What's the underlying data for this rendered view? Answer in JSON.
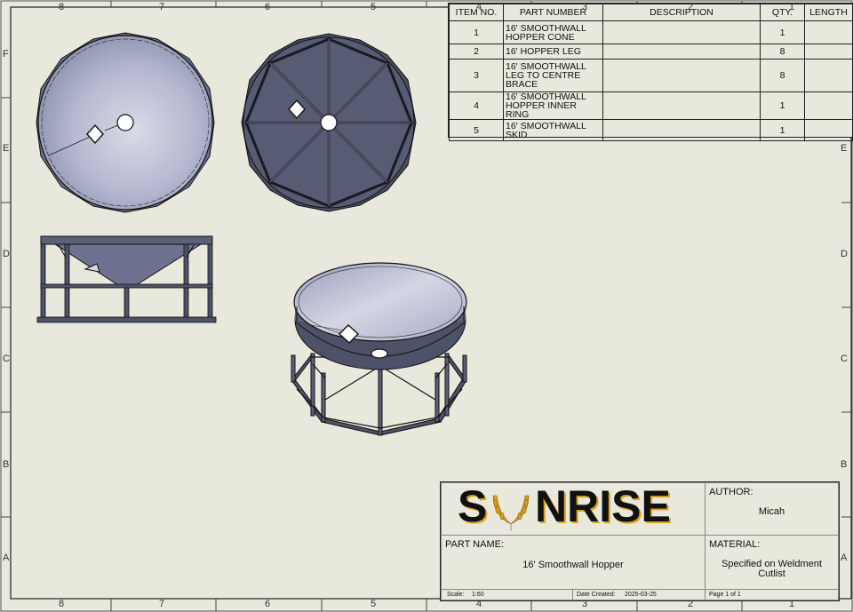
{
  "zones": {
    "columns": [
      "8",
      "7",
      "6",
      "5",
      "4",
      "3",
      "2",
      "1"
    ],
    "rows": [
      "F",
      "E",
      "D",
      "C",
      "B",
      "A"
    ]
  },
  "bom": {
    "headers": {
      "item_no": "ITEM NO.",
      "part_number": "PART NUMBER",
      "description": "DESCRIPTION",
      "qty": "QTY.",
      "length": "LENGTH"
    },
    "rows": [
      {
        "item": "1",
        "part": [
          "16' SMOOTHWALL",
          "HOPPER CONE"
        ],
        "description": "",
        "qty": "1",
        "length": ""
      },
      {
        "item": "2",
        "part": [
          "16' HOPPER LEG"
        ],
        "description": "",
        "qty": "8",
        "length": ""
      },
      {
        "item": "3",
        "part": [
          "16' SMOOTHWALL",
          "LEG TO CENTRE",
          "BRACE"
        ],
        "description": "",
        "qty": "8",
        "length": ""
      },
      {
        "item": "4",
        "part": [
          "16' SMOOTHWALL",
          "HOPPER INNER RING"
        ],
        "description": "",
        "qty": "1",
        "length": ""
      },
      {
        "item": "5",
        "part": [
          "16' SMOOTHWALL",
          "SKID"
        ],
        "description": "",
        "qty": "1",
        "length": ""
      }
    ]
  },
  "title_block": {
    "logo": "SUNRISE",
    "author_label": "AUTHOR:",
    "author": "Micah",
    "part_name_label": "PART NAME:",
    "part_name": "16' Smoothwall Hopper",
    "material_label": "MATERIAL:",
    "material": [
      "Specified on Weldment",
      "Cutlist"
    ],
    "scale_label": "Scale:",
    "scale": "1:60",
    "date_label": "Date Created:",
    "date": "2025-03-25",
    "page": "Page  1  of  1"
  },
  "colors": {
    "sheet": "#e8e8dc",
    "line": "#222222",
    "steel_light": "#b9bcd4",
    "steel_dark": "#545870",
    "logo_black": "#111111",
    "logo_gold": "#d9a21b"
  }
}
